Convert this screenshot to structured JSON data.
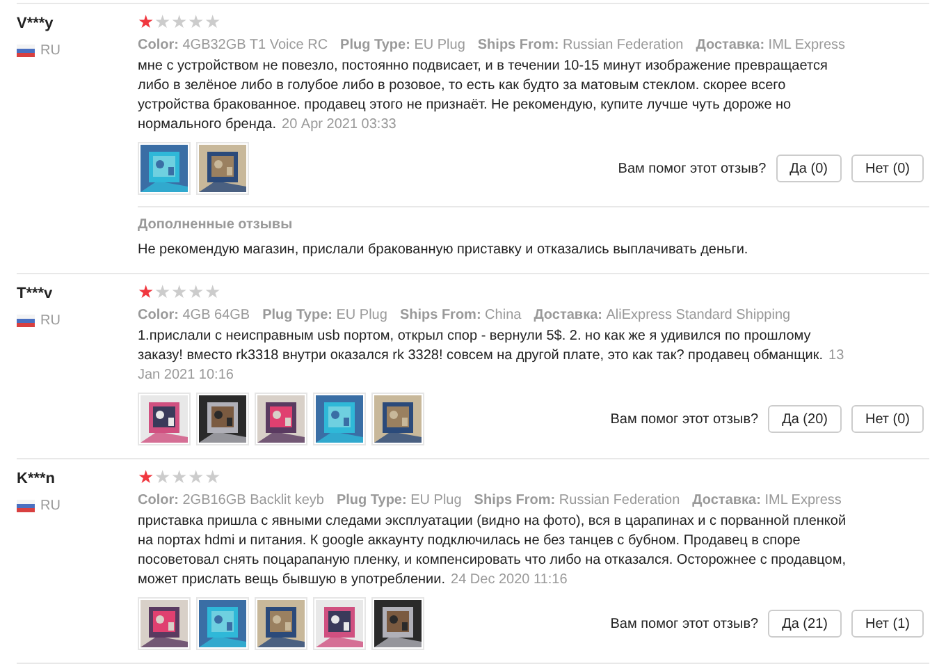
{
  "reviews": [
    {
      "author": "V***y",
      "country": "RU",
      "stars": 1,
      "attributes": [
        {
          "label": "Color:",
          "value": "4GB32GB T1 Voice RC"
        },
        {
          "label": "Plug Type:",
          "value": "EU Plug"
        },
        {
          "label": "Ships From:",
          "value": "Russian Federation"
        },
        {
          "label": "Доставка:",
          "value": "IML Express"
        }
      ],
      "text": "мне с устройством не повезло, постоянно подвисает, и в течении 10-15 минут изображение превращается либо в зелёное либо в голубое либо в розовое, то есть как будто за матовым стеклом. скорее всего устройства бракованное. продавец этого не признаёт. Не рекомендую, купите лучше чуть дороже но нормального бренда.",
      "date": "20 Apr 2021 03:33",
      "photos": [
        {
          "kind": "picture"
        },
        {
          "kind": "picture"
        }
      ],
      "helpful_prompt": "Вам помог этот отзыв?",
      "yes_button": "Да (0)",
      "no_button": "Нет (0)",
      "additional": {
        "heading": "Дополненные отзывы",
        "text": "Не рекомендую магазин, прислали бракованную приставку и отказались выплачивать деньги."
      }
    },
    {
      "author": "T***v",
      "country": "RU",
      "stars": 1,
      "attributes": [
        {
          "label": "Color:",
          "value": "4GB 64GB"
        },
        {
          "label": "Plug Type:",
          "value": "EU Plug"
        },
        {
          "label": "Ships From:",
          "value": "China"
        },
        {
          "label": "Доставка:",
          "value": "AliExpress Standard Shipping"
        }
      ],
      "text": "1.прислали с неисправным usb портом, открыл спор - вернули 5$. 2. но как же я удивился по прошлому заказу! вместо rk3318 внутри оказался rk 3328! совсем на другой плате, это как так? продавец обманщик.",
      "date": "13 Jan 2021 10:16",
      "photos": [
        {
          "kind": "picture"
        },
        {
          "kind": "picture"
        },
        {
          "kind": "picture"
        },
        {
          "kind": "picture"
        },
        {
          "kind": "picture"
        }
      ],
      "helpful_prompt": "Вам помог этот отзыв?",
      "yes_button": "Да (20)",
      "no_button": "Нет (0)"
    },
    {
      "author": "K***n",
      "country": "RU",
      "stars": 1,
      "attributes": [
        {
          "label": "Color:",
          "value": "2GB16GB Backlit keyb"
        },
        {
          "label": "Plug Type:",
          "value": "EU Plug"
        },
        {
          "label": "Ships From:",
          "value": "Russian Federation"
        },
        {
          "label": "Доставка:",
          "value": "IML Express"
        }
      ],
      "text": "приставка пришла с явными следами эксплуатации (видно на фото), вся в царапинах и с порванной пленкой на портах hdmi и питания. К google аккаунту подключилась не без танцев с бубном. Продавец в споре посоветовал снять поцарапаную пленку, и компенсировать что либо на отказался. Осторожнее с продавцом, может прислать вещь бывшую в употреблении.",
      "date": "24 Dec 2020 11:16",
      "photos": [
        {
          "kind": "picture"
        },
        {
          "kind": "picture"
        },
        {
          "kind": "picture"
        },
        {
          "kind": "picture"
        },
        {
          "kind": "picture"
        }
      ],
      "helpful_prompt": "Вам помог этот отзыв?",
      "yes_button": "Да (21)",
      "no_button": "Нет (1)"
    }
  ]
}
